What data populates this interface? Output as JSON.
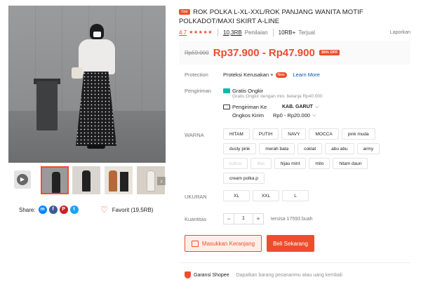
{
  "gallery": {
    "thumb_count": 5,
    "next_arrow": "›",
    "play_icon": "▶"
  },
  "share": {
    "label": "Share:",
    "icons": [
      "messenger-icon",
      "facebook-icon",
      "pinterest-icon",
      "twitter-icon"
    ]
  },
  "favorite": {
    "label": "Favorit (19,5RB)"
  },
  "product": {
    "badge": "Star",
    "title": "ROK POLKA L-XL-XXL/ROK PANJANG WANITA MOTIF POLKADOT/MAXI SKIRT A-LINE",
    "rating": "4.7",
    "stars": "★★★★★",
    "reviews_count": "10,3RB",
    "reviews_label": "Penilaian",
    "sold_count": "10RB+",
    "sold_label": "Terjual",
    "report": "Laporkan"
  },
  "price": {
    "original": "Rp59.000",
    "current": "Rp37.900 - Rp47.900",
    "discount": "36% OFF"
  },
  "protection": {
    "label": "Protection",
    "value": "Proteksi Kerusakan +",
    "new_badge": "New",
    "learn_more": "Learn More"
  },
  "shipping": {
    "label": "Pengiriman",
    "free": "Gratis Ongkir",
    "free_sub": "Gratis Ongkir dengan min. belanja Rp40.000",
    "to_label": "Pengiriman Ke",
    "to_value": "KAB. GARUT",
    "cost_label": "Ongkos Kirim",
    "cost_value": "Rp0 - Rp20.000"
  },
  "variation": {
    "label": "WARNA",
    "options": [
      {
        "name": "HITAM",
        "disabled": false
      },
      {
        "name": "PUTIH",
        "disabled": false
      },
      {
        "name": "NAVY",
        "disabled": false
      },
      {
        "name": "MOCCA",
        "disabled": false
      },
      {
        "name": "pink muda",
        "disabled": false
      },
      {
        "name": "dusty pink",
        "disabled": false
      },
      {
        "name": "merah bata",
        "disabled": false
      },
      {
        "name": "coklat",
        "disabled": false
      },
      {
        "name": "abu abu",
        "disabled": false
      },
      {
        "name": "army",
        "disabled": false
      },
      {
        "name": "kubus",
        "disabled": true
      },
      {
        "name": "lilac",
        "disabled": true
      },
      {
        "name": "hijau mint",
        "disabled": false
      },
      {
        "name": "milo",
        "disabled": false
      },
      {
        "name": "hitam daun",
        "disabled": false
      },
      {
        "name": "cream polka.p",
        "disabled": false
      }
    ]
  },
  "size": {
    "label": "UKURAN",
    "options": [
      "XL",
      "XXL",
      "L"
    ]
  },
  "quantity": {
    "label": "Kuantitas",
    "minus": "−",
    "value": "1",
    "plus": "+",
    "stock": "tersisa 17593 buah"
  },
  "actions": {
    "add_to_cart": "Masukkan Keranjang",
    "buy_now": "Beli Sekarang"
  },
  "guarantee": {
    "title": "Garansi Shopee",
    "subtitle": "Dapatkan barang pesananmu atau uang kembali"
  },
  "colors": {
    "accent": "#ee4d2d",
    "link": "#0055aa",
    "teal": "#00bfa5"
  }
}
